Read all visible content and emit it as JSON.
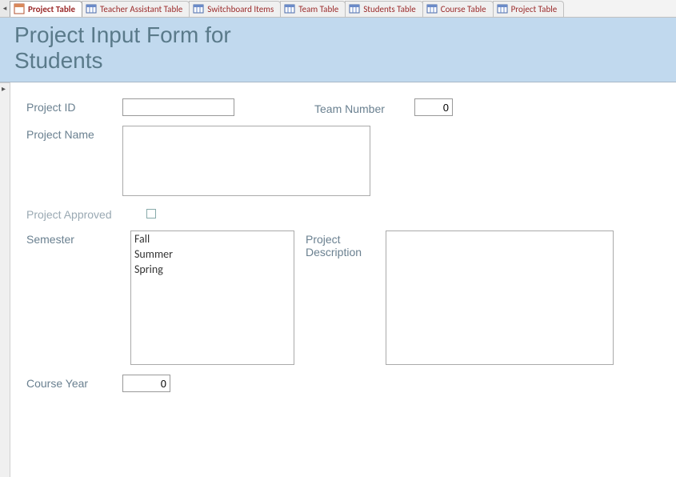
{
  "tabs": [
    {
      "label": "Project Table",
      "icon": "form",
      "active": true
    },
    {
      "label": "Teacher Assistant Table",
      "icon": "table",
      "active": false
    },
    {
      "label": "Switchboard Items",
      "icon": "table",
      "active": false
    },
    {
      "label": "Team Table",
      "icon": "table",
      "active": false
    },
    {
      "label": "Students Table",
      "icon": "table",
      "active": false
    },
    {
      "label": "Course Table",
      "icon": "table",
      "active": false
    },
    {
      "label": "Project Table",
      "icon": "table",
      "active": false
    }
  ],
  "header": {
    "title": "Project Input Form for Students"
  },
  "form": {
    "project_id": {
      "label": "Project ID",
      "value": ""
    },
    "team_number": {
      "label": "Team Number",
      "value": "0"
    },
    "project_name": {
      "label": "Project Name",
      "value": ""
    },
    "project_approved": {
      "label": "Project Approved",
      "checked": false
    },
    "semester": {
      "label": "Semester",
      "options": [
        "Fall",
        "Summer",
        "Spring"
      ]
    },
    "project_description": {
      "label": "Project Description",
      "value": ""
    },
    "course_year": {
      "label": "Course Year",
      "value": "0"
    }
  }
}
